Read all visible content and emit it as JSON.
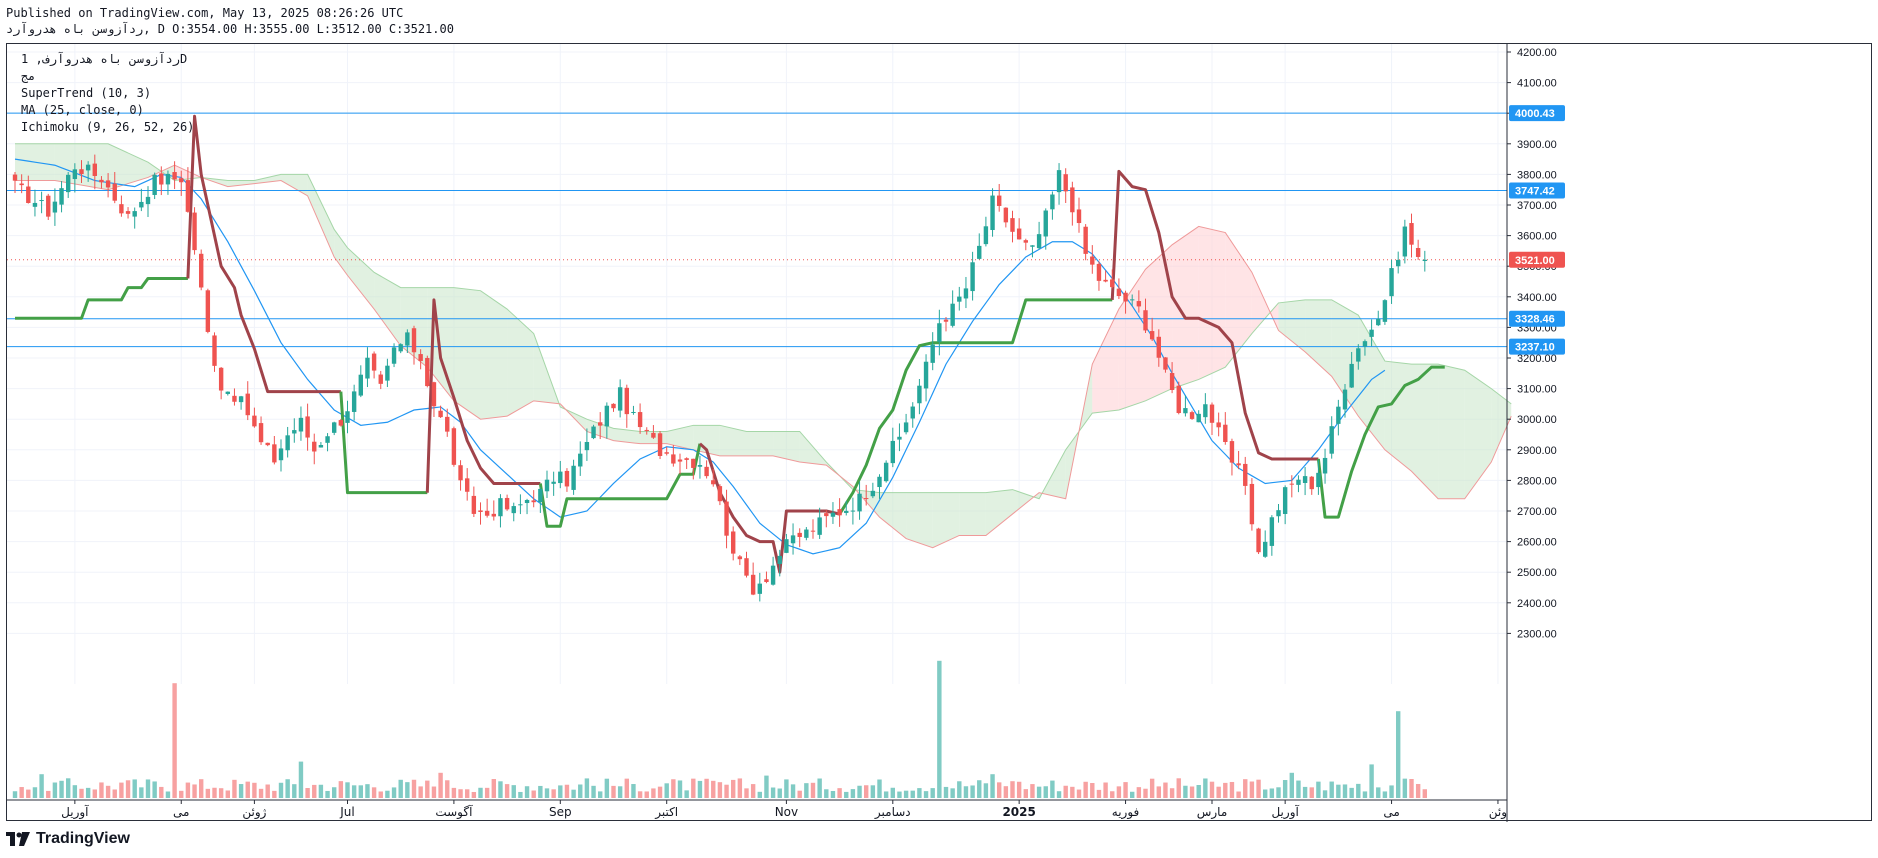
{
  "header": {
    "published": "Published on TradingView.com, May 13, 2025 08:26:26 UTC",
    "ohlc": "ردآزوسن باه هدروآرد, D O:3554.00 H:3555.00 L:3512.00 C:3521.00"
  },
  "legend": {
    "symbol": "ردآزوسن باه هدروآرف, 1D",
    "exchange": "مج",
    "supertrend": "SuperTrend (10, 3)",
    "ma": "MA (25, close, 0)",
    "ichimoku": "Ichimoku (9, 26, 52, 26)"
  },
  "footer": {
    "brand": "TradingView",
    "logo_icon": "tradingview-logo-icon"
  },
  "colors": {
    "up": "#26a69a",
    "down": "#ef5350",
    "supertrend_up": "#43a047",
    "supertrend_down": "#a0434a",
    "ma": "#2196f3",
    "hline": "#2196f3",
    "last_price": "#ef5350",
    "cloud_bull": "#c8e6c9",
    "cloud_bear": "#ffcdd2",
    "volume_up": "#80cbc4",
    "volume_down": "#f7a1a1"
  },
  "chart_data": {
    "type": "candlestick",
    "y_axis": {
      "min": 2200,
      "max": 4200,
      "ticks": [
        4200,
        4100,
        4000,
        3900,
        3800,
        3700,
        3600,
        3500,
        3400,
        3300,
        3200,
        3100,
        3000,
        2900,
        2800,
        2700,
        2600,
        2500,
        2400,
        2300
      ]
    },
    "x_axis": {
      "labels": [
        {
          "text": "آوریل",
          "bar": 9
        },
        {
          "text": "می",
          "bar": 25
        },
        {
          "text": "ژوئن",
          "bar": 36
        },
        {
          "text": "Jul",
          "bar": 50
        },
        {
          "text": "آگوست",
          "bar": 66
        },
        {
          "text": "Sep",
          "bar": 82
        },
        {
          "text": "اکتبر",
          "bar": 98
        },
        {
          "text": "Nov",
          "bar": 116
        },
        {
          "text": "دسامبر",
          "bar": 132
        },
        {
          "text": "2025",
          "bar": 151,
          "bold": true
        },
        {
          "text": "فوریه",
          "bar": 167
        },
        {
          "text": "مارس",
          "bar": 180
        },
        {
          "text": "آوریل",
          "bar": 191
        },
        {
          "text": "می",
          "bar": 207
        },
        {
          "text": "وئن",
          "bar": 223
        }
      ],
      "total_bars": 225
    },
    "price_lines": [
      {
        "value": 4000.43,
        "label": "4000.43",
        "style": "solid"
      },
      {
        "value": 3747.42,
        "label": "3747.42",
        "style": "solid"
      },
      {
        "value": 3328.46,
        "label": "3328.46",
        "style": "solid"
      },
      {
        "value": 3237.1,
        "label": "3237.10",
        "style": "solid"
      },
      {
        "value": 3521.0,
        "label": "3521.00",
        "style": "dotted",
        "last": true
      }
    ],
    "price_anchors": [
      [
        0,
        3760
      ],
      [
        5,
        3680
      ],
      [
        9,
        3830
      ],
      [
        13,
        3790
      ],
      [
        17,
        3660
      ],
      [
        21,
        3780
      ],
      [
        25,
        3790
      ],
      [
        27,
        3560
      ],
      [
        29,
        3280
      ],
      [
        31,
        3110
      ],
      [
        33,
        3080
      ],
      [
        35,
        3020
      ],
      [
        37,
        2920
      ],
      [
        39,
        2870
      ],
      [
        41,
        2950
      ],
      [
        43,
        2990
      ],
      [
        45,
        2900
      ],
      [
        47,
        2960
      ],
      [
        49,
        3000
      ],
      [
        51,
        3080
      ],
      [
        53,
        3180
      ],
      [
        55,
        3100
      ],
      [
        57,
        3230
      ],
      [
        59,
        3260
      ],
      [
        61,
        3200
      ],
      [
        63,
        3050
      ],
      [
        65,
        2950
      ],
      [
        67,
        2780
      ],
      [
        69,
        2700
      ],
      [
        71,
        2690
      ],
      [
        73,
        2720
      ],
      [
        75,
        2700
      ],
      [
        77,
        2740
      ],
      [
        79,
        2760
      ],
      [
        81,
        2810
      ],
      [
        83,
        2800
      ],
      [
        85,
        2880
      ],
      [
        87,
        2960
      ],
      [
        89,
        3030
      ],
      [
        91,
        3080
      ],
      [
        93,
        3000
      ],
      [
        95,
        2950
      ],
      [
        97,
        2900
      ],
      [
        99,
        2880
      ],
      [
        101,
        2870
      ],
      [
        103,
        2860
      ],
      [
        105,
        2800
      ],
      [
        107,
        2640
      ],
      [
        109,
        2520
      ],
      [
        111,
        2450
      ],
      [
        113,
        2490
      ],
      [
        115,
        2560
      ],
      [
        117,
        2610
      ],
      [
        119,
        2630
      ],
      [
        121,
        2660
      ],
      [
        123,
        2690
      ],
      [
        125,
        2710
      ],
      [
        127,
        2740
      ],
      [
        129,
        2790
      ],
      [
        131,
        2870
      ],
      [
        133,
        2940
      ],
      [
        135,
        3050
      ],
      [
        137,
        3170
      ],
      [
        139,
        3320
      ],
      [
        141,
        3360
      ],
      [
        143,
        3430
      ],
      [
        145,
        3560
      ],
      [
        147,
        3710
      ],
      [
        149,
        3650
      ],
      [
        151,
        3580
      ],
      [
        153,
        3550
      ],
      [
        155,
        3660
      ],
      [
        157,
        3800
      ],
      [
        159,
        3700
      ],
      [
        161,
        3540
      ],
      [
        163,
        3460
      ],
      [
        165,
        3420
      ],
      [
        167,
        3390
      ],
      [
        169,
        3360
      ],
      [
        171,
        3270
      ],
      [
        173,
        3140
      ],
      [
        175,
        3040
      ],
      [
        177,
        3020
      ],
      [
        179,
        3050
      ],
      [
        181,
        2950
      ],
      [
        183,
        2860
      ],
      [
        185,
        2790
      ],
      [
        187,
        2560
      ],
      [
        189,
        2670
      ],
      [
        191,
        2760
      ],
      [
        193,
        2810
      ],
      [
        195,
        2790
      ],
      [
        197,
        2880
      ],
      [
        199,
        3040
      ],
      [
        201,
        3200
      ],
      [
        203,
        3270
      ],
      [
        205,
        3330
      ],
      [
        207,
        3470
      ],
      [
        209,
        3620
      ],
      [
        211,
        3530
      ],
      [
        212,
        3521
      ]
    ],
    "ma_anchors": [
      [
        0,
        3850
      ],
      [
        6,
        3830
      ],
      [
        12,
        3780
      ],
      [
        18,
        3760
      ],
      [
        22,
        3800
      ],
      [
        25,
        3790
      ],
      [
        28,
        3720
      ],
      [
        32,
        3580
      ],
      [
        36,
        3420
      ],
      [
        40,
        3250
      ],
      [
        44,
        3130
      ],
      [
        48,
        3030
      ],
      [
        52,
        2980
      ],
      [
        56,
        2990
      ],
      [
        60,
        3030
      ],
      [
        64,
        3040
      ],
      [
        67,
        2990
      ],
      [
        70,
        2900
      ],
      [
        74,
        2820
      ],
      [
        78,
        2740
      ],
      [
        82,
        2680
      ],
      [
        86,
        2700
      ],
      [
        90,
        2790
      ],
      [
        94,
        2870
      ],
      [
        98,
        2910
      ],
      [
        102,
        2900
      ],
      [
        105,
        2860
      ],
      [
        108,
        2780
      ],
      [
        112,
        2660
      ],
      [
        116,
        2590
      ],
      [
        120,
        2560
      ],
      [
        124,
        2580
      ],
      [
        128,
        2660
      ],
      [
        132,
        2810
      ],
      [
        136,
        2990
      ],
      [
        140,
        3180
      ],
      [
        144,
        3320
      ],
      [
        148,
        3440
      ],
      [
        152,
        3530
      ],
      [
        156,
        3580
      ],
      [
        159,
        3580
      ],
      [
        162,
        3540
      ],
      [
        165,
        3460
      ],
      [
        168,
        3370
      ],
      [
        171,
        3270
      ],
      [
        174,
        3150
      ],
      [
        177,
        3040
      ],
      [
        180,
        2930
      ],
      [
        184,
        2840
      ],
      [
        188,
        2790
      ],
      [
        192,
        2800
      ],
      [
        196,
        2900
      ],
      [
        200,
        3020
      ],
      [
        204,
        3130
      ],
      [
        206,
        3160
      ]
    ],
    "supertrend_segments": [
      {
        "trend": "up",
        "points": [
          [
            0,
            3330
          ],
          [
            10,
            3330
          ],
          [
            11,
            3390
          ],
          [
            16,
            3390
          ],
          [
            17,
            3430
          ],
          [
            19,
            3430
          ],
          [
            20,
            3460
          ],
          [
            26,
            3460
          ]
        ]
      },
      {
        "trend": "down",
        "points": [
          [
            26,
            3460
          ],
          [
            27,
            3990
          ],
          [
            28,
            3800
          ],
          [
            30,
            3600
          ],
          [
            31,
            3500
          ],
          [
            33,
            3430
          ],
          [
            34,
            3340
          ],
          [
            36,
            3230
          ],
          [
            38,
            3090
          ],
          [
            49,
            3090
          ]
        ]
      },
      {
        "trend": "up",
        "points": [
          [
            49,
            3090
          ],
          [
            50,
            2760
          ],
          [
            62,
            2760
          ]
        ]
      },
      {
        "trend": "down",
        "points": [
          [
            62,
            2760
          ],
          [
            63,
            3390
          ],
          [
            64,
            3200
          ],
          [
            66,
            3070
          ],
          [
            68,
            2930
          ],
          [
            70,
            2840
          ],
          [
            72,
            2790
          ],
          [
            79,
            2790
          ]
        ]
      },
      {
        "trend": "up",
        "points": [
          [
            79,
            2790
          ],
          [
            80,
            2650
          ],
          [
            82,
            2650
          ],
          [
            83,
            2740
          ],
          [
            98,
            2740
          ],
          [
            100,
            2820
          ],
          [
            102,
            2820
          ],
          [
            103,
            2920
          ]
        ]
      },
      {
        "trend": "down",
        "points": [
          [
            103,
            2920
          ],
          [
            104,
            2900
          ],
          [
            106,
            2760
          ],
          [
            108,
            2680
          ],
          [
            110,
            2620
          ],
          [
            112,
            2600
          ],
          [
            114,
            2600
          ],
          [
            115,
            2500
          ],
          [
            116,
            2700
          ],
          [
            122,
            2700
          ],
          [
            124,
            2690
          ]
        ]
      },
      {
        "trend": "up",
        "points": [
          [
            124,
            2690
          ],
          [
            126,
            2760
          ],
          [
            128,
            2850
          ],
          [
            130,
            2970
          ],
          [
            132,
            3030
          ],
          [
            134,
            3160
          ],
          [
            136,
            3240
          ],
          [
            138,
            3250
          ],
          [
            150,
            3250
          ],
          [
            152,
            3390
          ],
          [
            165,
            3390
          ]
        ]
      },
      {
        "trend": "down",
        "points": [
          [
            165,
            3390
          ],
          [
            166,
            3810
          ],
          [
            168,
            3760
          ],
          [
            170,
            3750
          ],
          [
            172,
            3610
          ],
          [
            174,
            3400
          ],
          [
            176,
            3330
          ],
          [
            178,
            3330
          ],
          [
            181,
            3300
          ],
          [
            183,
            3250
          ],
          [
            185,
            3020
          ],
          [
            187,
            2890
          ],
          [
            189,
            2870
          ],
          [
            196,
            2870
          ]
        ]
      },
      {
        "trend": "up",
        "points": [
          [
            196,
            2870
          ],
          [
            197,
            2680
          ],
          [
            199,
            2680
          ],
          [
            201,
            2830
          ],
          [
            203,
            2950
          ],
          [
            205,
            3040
          ],
          [
            207,
            3050
          ],
          [
            209,
            3110
          ],
          [
            211,
            3130
          ],
          [
            213,
            3170
          ],
          [
            215,
            3170
          ]
        ]
      }
    ],
    "cloud_anchors": [
      [
        0,
        3900,
        3780
      ],
      [
        6,
        3900,
        3780
      ],
      [
        14,
        3900,
        3750
      ],
      [
        20,
        3840,
        3790
      ],
      [
        24,
        3780,
        3830
      ],
      [
        28,
        3790,
        3790
      ],
      [
        32,
        3780,
        3760
      ],
      [
        36,
        3780,
        3770
      ],
      [
        40,
        3800,
        3780
      ],
      [
        44,
        3800,
        3730
      ],
      [
        48,
        3620,
        3530
      ],
      [
        50,
        3560,
        3470
      ],
      [
        54,
        3480,
        3360
      ],
      [
        58,
        3430,
        3240
      ],
      [
        62,
        3430,
        3170
      ],
      [
        66,
        3430,
        3060
      ],
      [
        70,
        3420,
        3000
      ],
      [
        74,
        3360,
        3010
      ],
      [
        78,
        3280,
        3060
      ],
      [
        82,
        3040,
        3050
      ],
      [
        86,
        3000,
        2960
      ],
      [
        90,
        2970,
        2930
      ],
      [
        94,
        2960,
        2920
      ],
      [
        98,
        2960,
        2920
      ],
      [
        102,
        2980,
        2900
      ],
      [
        106,
        2980,
        2880
      ],
      [
        110,
        2960,
        2880
      ],
      [
        114,
        2960,
        2880
      ],
      [
        118,
        2960,
        2860
      ],
      [
        122,
        2860,
        2850
      ],
      [
        126,
        2770,
        2780
      ],
      [
        130,
        2760,
        2680
      ],
      [
        134,
        2760,
        2610
      ],
      [
        138,
        2760,
        2580
      ],
      [
        142,
        2760,
        2620
      ],
      [
        146,
        2760,
        2620
      ],
      [
        150,
        2770,
        2690
      ],
      [
        154,
        2740,
        2760
      ],
      [
        158,
        2900,
        2740
      ],
      [
        162,
        3020,
        3180
      ],
      [
        166,
        3030,
        3360
      ],
      [
        170,
        3060,
        3490
      ],
      [
        174,
        3100,
        3570
      ],
      [
        178,
        3130,
        3630
      ],
      [
        182,
        3170,
        3610
      ],
      [
        186,
        3280,
        3480
      ],
      [
        190,
        3380,
        3290
      ],
      [
        194,
        3390,
        3220
      ],
      [
        198,
        3390,
        3140
      ],
      [
        202,
        3340,
        3010
      ],
      [
        206,
        3190,
        2900
      ],
      [
        210,
        3180,
        2830
      ],
      [
        214,
        3180,
        2740
      ],
      [
        218,
        3160,
        2740
      ],
      [
        222,
        3100,
        2860
      ],
      [
        225,
        3050,
        3010
      ]
    ],
    "spikes": [
      [
        4,
        0.85
      ],
      [
        16,
        0.55
      ],
      [
        24,
        4.1
      ],
      [
        43,
        1.3
      ],
      [
        64,
        0.9
      ],
      [
        86,
        0.7
      ],
      [
        113,
        0.8
      ],
      [
        139,
        4.9
      ],
      [
        147,
        0.85
      ],
      [
        150,
        0.6
      ],
      [
        192,
        0.9
      ],
      [
        204,
        1.2
      ],
      [
        208,
        3.1
      ]
    ]
  }
}
